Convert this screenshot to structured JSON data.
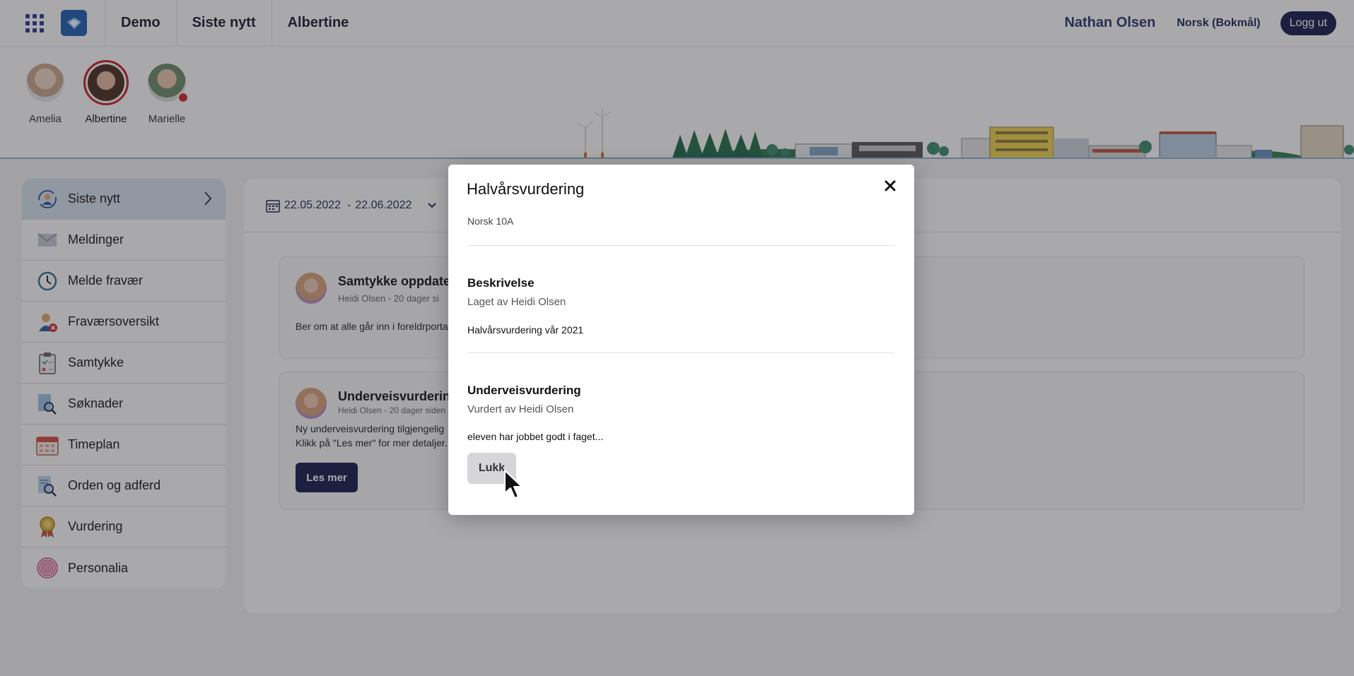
{
  "topbar": {
    "nav": [
      "Demo",
      "Siste nytt",
      "Albertine"
    ],
    "user_name": "Nathan Olsen",
    "language": "Norsk (Bokmål)",
    "logout_label": "Logg ut"
  },
  "children": [
    {
      "name": "Amelia",
      "selected": false
    },
    {
      "name": "Albertine",
      "selected": true
    },
    {
      "name": "Marielle",
      "selected": false,
      "badge": true
    }
  ],
  "sidebar": {
    "items": [
      {
        "label": "Siste nytt",
        "icon": "news-icon",
        "active": true
      },
      {
        "label": "Meldinger",
        "icon": "envelope-icon"
      },
      {
        "label": "Melde fravær",
        "icon": "clock-icon"
      },
      {
        "label": "Fraværsoversikt",
        "icon": "absence-person-icon"
      },
      {
        "label": "Samtykke",
        "icon": "clipboard-icon"
      },
      {
        "label": "Søknader",
        "icon": "document-search-icon"
      },
      {
        "label": "Timeplan",
        "icon": "calendar-icon"
      },
      {
        "label": "Orden og adferd",
        "icon": "document-magnifier-icon"
      },
      {
        "label": "Vurdering",
        "icon": "medal-icon"
      },
      {
        "label": "Personalia",
        "icon": "fingerprint-icon"
      }
    ]
  },
  "filter": {
    "date_from": "22.05.2022",
    "date_separator": "-",
    "date_to": "22.06.2022"
  },
  "feed": [
    {
      "title": "Samtykke oppdate",
      "meta": "Heidi Olsen - 20 dager si",
      "body": "Ber om at alle går inn i foreldrporta"
    },
    {
      "title": "Underveisvurderin",
      "meta": "Heidi Olsen - 20 dager siden",
      "body_line1": "Ny underveisvurdering tilgjengelig",
      "body_line2": "Klikk på \"Les mer\" for mer detaljer.",
      "button": "Les mer"
    }
  ],
  "modal": {
    "title": "Halvårsvurdering",
    "subject": "Norsk 10A",
    "section1": {
      "heading": "Beskrivelse",
      "meta": "Laget av Heidi Olsen",
      "text": "Halvårsvurdering vår 2021"
    },
    "section2": {
      "heading": "Underveisvurdering",
      "meta": "Vurdert av Heidi Olsen",
      "text": "eleven har jobbet godt i faget..."
    },
    "close_label": "Lukk"
  }
}
